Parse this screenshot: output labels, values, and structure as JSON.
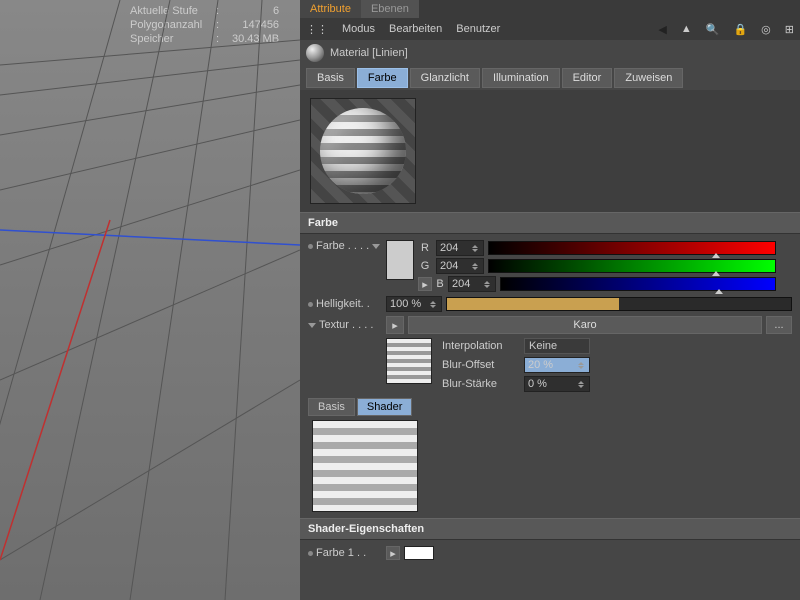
{
  "stats": {
    "level_label": "Aktuelle Stufe",
    "level_value": "6",
    "poly_label": "Polygonanzahl",
    "poly_value": "147456",
    "mem_label": "Speicher",
    "mem_value": "30.43 MB"
  },
  "panel_tabs": {
    "attribute": "Attribute",
    "ebenen": "Ebenen"
  },
  "toolbar": {
    "modus": "Modus",
    "bearbeiten": "Bearbeiten",
    "benutzer": "Benutzer"
  },
  "material_title": "Material [Linien]",
  "mat_tabs": {
    "basis": "Basis",
    "farbe": "Farbe",
    "glanzlicht": "Glanzlicht",
    "illumination": "Illumination",
    "editor": "Editor",
    "zuweisen": "Zuweisen"
  },
  "color_section": {
    "header": "Farbe",
    "farbe_label": "Farbe . . . .",
    "helligkeit_label": "Helligkeit. .",
    "textur_label": "Textur . . . .",
    "r": "R",
    "g": "G",
    "b": "B",
    "r_val": "204",
    "g_val": "204",
    "b_val": "204",
    "helligkeit_val": "100 %",
    "textur_shader": "Karo",
    "textur_more": "...",
    "interpolation_label": "Interpolation",
    "interpolation_val": "Keine",
    "blur_offset_label": "Blur-Offset",
    "blur_offset_val": "20 %",
    "blur_staerke_label": "Blur-Stärke",
    "blur_staerke_val": "0 %"
  },
  "subtabs": {
    "basis": "Basis",
    "shader": "Shader"
  },
  "shader_props": {
    "header": "Shader-Eigenschaften",
    "farbe1_label": "Farbe 1 . ."
  }
}
